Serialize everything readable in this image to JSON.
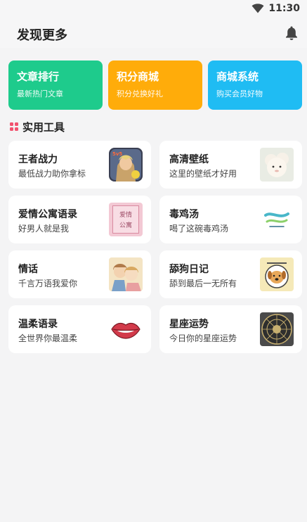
{
  "status": {
    "time": "11:30"
  },
  "header": {
    "title": "发现更多"
  },
  "banners": [
    {
      "title": "文章排行",
      "subtitle": "最新热门文章",
      "color": "#1ecb8c"
    },
    {
      "title": "积分商城",
      "subtitle": "积分兑换好礼",
      "color": "#ffac0a"
    },
    {
      "title": "商城系统",
      "subtitle": "购买会员好物",
      "color": "#1fbcf3"
    }
  ],
  "section": {
    "title": "实用工具",
    "icon": "grid-icon",
    "icon_color": "#f2526f"
  },
  "tools": [
    {
      "title": "王者战力",
      "subtitle": "最低战力助你拿标",
      "icon": "game-hero-thumbnail"
    },
    {
      "title": "高清壁纸",
      "subtitle": "这里的壁纸才好用",
      "icon": "fluffy-toy-thumbnail"
    },
    {
      "title": "爱情公寓语录",
      "subtitle": "好男人就是我",
      "icon": "apartment-sign-thumbnail",
      "thumb_text": [
        "爱情",
        "公寓"
      ]
    },
    {
      "title": "毒鸡汤",
      "subtitle": "喝了这碗毒鸡汤",
      "icon": "wave-logo-thumbnail"
    },
    {
      "title": "情话",
      "subtitle": "千言万语我爱你",
      "icon": "couple-illustration-thumbnail"
    },
    {
      "title": "舔狗日记",
      "subtitle": "舔到最后一无所有",
      "icon": "dog-astronaut-thumbnail"
    },
    {
      "title": "温柔语录",
      "subtitle": "全世界你最温柔",
      "icon": "lips-thumbnail"
    },
    {
      "title": "星座运势",
      "subtitle": "今日你的星座运势",
      "icon": "zodiac-wheel-thumbnail"
    }
  ]
}
